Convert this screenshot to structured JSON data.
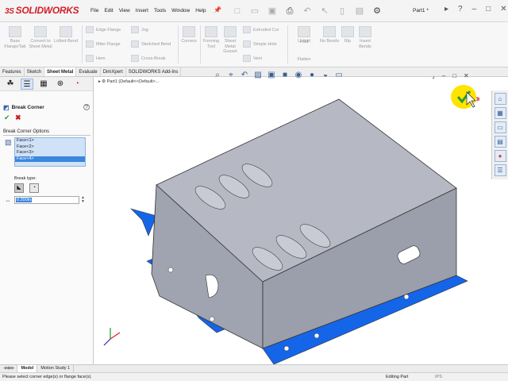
{
  "app": {
    "logo_prefix": "3S",
    "logo_text": "SOLIDWORKS",
    "menu": [
      "File",
      "Edit",
      "View",
      "Insert",
      "Tools",
      "Window",
      "Help"
    ],
    "doc_name": "Part1 *"
  },
  "ribbon": {
    "buttons": [
      {
        "label": "Base Flange/Tab"
      },
      {
        "label": "Convert to Sheet Metal"
      },
      {
        "label": "Lofted-Bend"
      },
      {
        "label": "Corners"
      },
      {
        "label": "Forming Tool"
      },
      {
        "label": "Sheet Metal Gusset"
      },
      {
        "label": "Unfold"
      },
      {
        "label": "Fold"
      },
      {
        "label": "Flatten"
      },
      {
        "label": "No Bends"
      },
      {
        "label": "Rip"
      },
      {
        "label": "Insert Bends"
      }
    ],
    "small": [
      {
        "label": "Edge Flange"
      },
      {
        "label": "Jog"
      },
      {
        "label": "Miter Flange"
      },
      {
        "label": "Sketched Bend"
      },
      {
        "label": "Hem"
      },
      {
        "label": "Cross-Break"
      },
      {
        "label": "Extruded Cut"
      },
      {
        "label": "Simple Hole"
      },
      {
        "label": "Vent"
      }
    ]
  },
  "tabs": [
    "Features",
    "Sketch",
    "Sheet Metal",
    "Evaluate",
    "DimXpert",
    "SOLIDWORKS Add-Ins"
  ],
  "active_tab": "Sheet Metal",
  "property_manager": {
    "title": "Break Corner",
    "help": "?",
    "group_title": "Break Corner Options",
    "faces": [
      "Face<1>",
      "Face<2>",
      "Face<3>",
      "Face<4>"
    ],
    "selected_face_index": 3,
    "break_type_label": "Break type:",
    "distance_value": "0.200in"
  },
  "graphics": {
    "tree_label": "Part1  (Default<<Default>..."
  },
  "bottom_tabs": [
    "Model",
    "Motion Study 1"
  ],
  "active_bottom_tab": "Model",
  "status": {
    "message": "Please select corner edge(s) or flange face(s).",
    "mode": "Editing Part",
    "units": "IPS"
  },
  "colors": {
    "accent": "#3c86dd",
    "brand": "#d21f28",
    "flange_blue": "#1565e8",
    "part_gray": "#b4b6c2",
    "confirm_yellow": "#ffe400",
    "ok_green": "#2c9a36",
    "cancel_red": "#cc1b1b"
  },
  "icons": {
    "ok": "checkmark-icon",
    "cancel": "x-icon",
    "feature_manager": "feature-tree-icon",
    "property_manager": "property-icon",
    "config_manager": "configuration-icon",
    "dimxpert": "crosshair-icon",
    "display": "pie-icon"
  }
}
